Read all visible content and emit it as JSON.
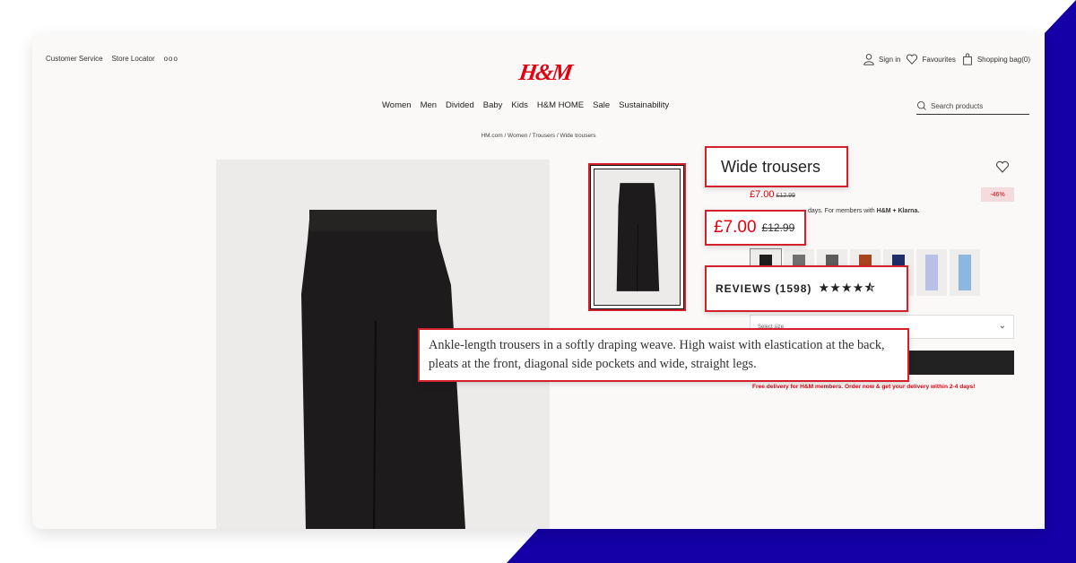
{
  "page": {
    "accent_color": "#e50010",
    "background_shape_color": "#1400a6"
  },
  "header": {
    "top_left": [
      "Customer Service",
      "Store Locator",
      "ooo"
    ],
    "logo": "H&M",
    "top_right": {
      "sign_in": "Sign in",
      "favourites": "Favourites",
      "shopping_bag": "Shopping bag(0)"
    },
    "nav": [
      "Women",
      "Men",
      "Divided",
      "Baby",
      "Kids",
      "H&M HOME",
      "Sale",
      "Sustainability"
    ],
    "search_placeholder": "Search products"
  },
  "breadcrumb": "HM.com / Women / Trousers / Wide trousers",
  "product": {
    "title": "Wide trousers",
    "price": "£7.00",
    "original_price": "£12.99",
    "discount_badge": "-46%",
    "klarna_text": "days. For members with",
    "klarna_brand": "H&M + Klarna.",
    "reviews_label": "REVIEWS (1598)",
    "rating_stars": 4.5,
    "stars_text": "★★★★⯪",
    "swatch_colors": [
      "#1e1e1e",
      "#707070",
      "#5c5c5c",
      "#a8441f",
      "#1d2e6b",
      "#b8c0e8",
      "#8bb8e0"
    ],
    "size_select_placeholder": "Select size",
    "description": "Ankle-length trousers in a softly draping weave. High waist with elastication at the back, pleats at the front, diagonal side pockets and wide, straight legs.",
    "delivery_note": "Free delivery for H&M members. Order now & get your delivery within 2-4 days!"
  },
  "icons": {
    "sign_in": "user-icon",
    "favourites": "heart-icon",
    "bag": "shopping-bag-icon",
    "search": "search-icon",
    "chevron": "chevron-down-icon"
  }
}
